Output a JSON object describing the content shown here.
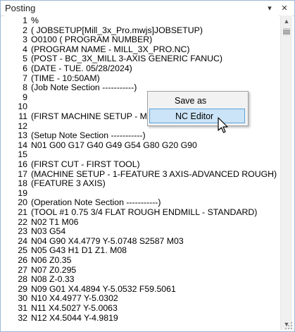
{
  "window": {
    "title": "Posting",
    "pin_glyph": "▾",
    "close_glyph": "✕"
  },
  "editor": {
    "lines": [
      {
        "num": "1",
        "text": "%"
      },
      {
        "num": "2",
        "text": "( JOBSETUP[Mill_3x_Pro.mwjs]JOBSETUP)"
      },
      {
        "num": "3",
        "text": "O0100 ( PROGRAM NUMBER)"
      },
      {
        "num": "4",
        "text": "(PROGRAM NAME - MILL_3X_PRO.NC)"
      },
      {
        "num": "5",
        "text": "(POST -  BC_3X_MILL 3-AXIS GENERIC FANUC)"
      },
      {
        "num": "6",
        "text": "(DATE - TUE. 05/28/2024)"
      },
      {
        "num": "7",
        "text": "(TIME - 10:50AM)"
      },
      {
        "num": "8",
        "text": "(Job Note Section -----------)"
      },
      {
        "num": "9",
        "text": ""
      },
      {
        "num": "10",
        "text": ""
      },
      {
        "num": "11",
        "text": "(FIRST MACHINE SETUP - MA"
      },
      {
        "num": "12",
        "text": ""
      },
      {
        "num": "13",
        "text": "(Setup Note Section -----------)"
      },
      {
        "num": "14",
        "text": "N01 G00 G17 G40 G49 G54 G80 G20 G90"
      },
      {
        "num": "15",
        "text": ""
      },
      {
        "num": "16",
        "text": "(FIRST CUT - FIRST TOOL)"
      },
      {
        "num": "17",
        "text": "(MACHINE SETUP - 1-FEATURE 3 AXIS-ADVANCED ROUGH)"
      },
      {
        "num": "18",
        "text": "(FEATURE 3 AXIS)"
      },
      {
        "num": "19",
        "text": ""
      },
      {
        "num": "20",
        "text": "(Operation Note Section -----------)"
      },
      {
        "num": "21",
        "text": "(TOOL #1 0.75 3/4 FLAT ROUGH ENDMILL - STANDARD)"
      },
      {
        "num": "22",
        "text": "N02 T1 M06"
      },
      {
        "num": "23",
        "text": "N03 G54"
      },
      {
        "num": "24",
        "text": "N04 G90 X4.4779 Y-5.0748 S2587 M03"
      },
      {
        "num": "25",
        "text": "N05 G43 H1 D1 Z1. M08"
      },
      {
        "num": "26",
        "text": "N06 Z0.35"
      },
      {
        "num": "27",
        "text": "N07 Z0.295"
      },
      {
        "num": "28",
        "text": "N08 Z-0.33"
      },
      {
        "num": "29",
        "text": "N09 G01 X4.4894 Y-5.0532 F59.5061"
      },
      {
        "num": "30",
        "text": "N10 X4.4977 Y-5.0302"
      },
      {
        "num": "31",
        "text": "N11 X4.5027 Y-5.0063"
      },
      {
        "num": "32",
        "text": "N12 X4.5044 Y-4.9819"
      }
    ]
  },
  "scrollbar": {
    "up_glyph": "▲",
    "down_glyph": "▼"
  },
  "context_menu": {
    "items": [
      {
        "label": "Save as",
        "hover": false
      },
      {
        "label": "NC Editor",
        "hover": true
      }
    ]
  }
}
